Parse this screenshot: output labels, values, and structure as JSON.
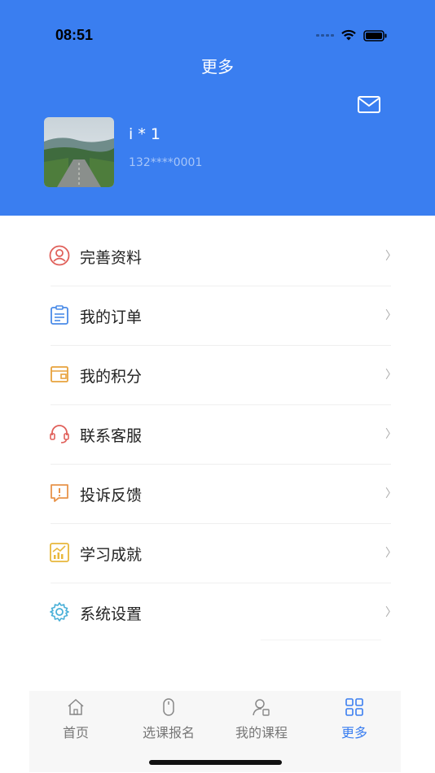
{
  "status_bar": {
    "time": "08:51"
  },
  "header": {
    "title": "更多"
  },
  "user": {
    "name": "i * 1",
    "phone": "132****0001"
  },
  "menu": [
    {
      "label": "完善资料",
      "icon": "user-profile-icon",
      "color": "#e0605a"
    },
    {
      "label": "我的订单",
      "icon": "order-clipboard-icon",
      "color": "#4a8be8"
    },
    {
      "label": "我的积分",
      "icon": "wallet-icon",
      "color": "#e8a23c"
    },
    {
      "label": "联系客服",
      "icon": "headset-icon",
      "color": "#e0605a"
    },
    {
      "label": "投诉反馈",
      "icon": "feedback-icon",
      "color": "#e8944a"
    },
    {
      "label": "学习成就",
      "icon": "achievement-chart-icon",
      "color": "#e8b83c"
    },
    {
      "label": "系统设置",
      "icon": "gear-icon",
      "color": "#4ab0d8"
    }
  ],
  "chevron": "〉",
  "tabs": [
    {
      "label": "首页",
      "icon": "home-icon"
    },
    {
      "label": "选课报名",
      "icon": "mouse-icon"
    },
    {
      "label": "我的课程",
      "icon": "user-course-icon"
    },
    {
      "label": "更多",
      "icon": "grid-icon",
      "active": true
    }
  ],
  "colors": {
    "primary": "#3a7ef0",
    "tab_inactive": "#777777"
  }
}
